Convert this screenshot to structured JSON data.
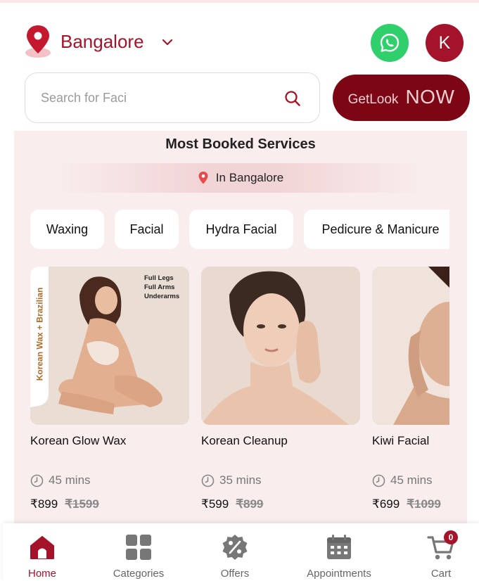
{
  "header": {
    "city": "Bangalore",
    "avatar_initial": "K",
    "search_placeholder": "Search for Faci",
    "cta_getlook": "GetLook",
    "cta_now": "NOW"
  },
  "section": {
    "title": "Most Booked Services",
    "location_label": "In Bangalore"
  },
  "chips": [
    "Waxing",
    "Facial",
    "Hydra Facial",
    "Pedicure & Manicure"
  ],
  "cards": [
    {
      "name": "Korean Glow Wax",
      "duration": "45 mins",
      "price": "₹899",
      "mrp": "₹1599",
      "image_side_text": "Korean Wax + Brazilian",
      "image_list": [
        "Full Legs",
        "Full Arms",
        "Underarms"
      ]
    },
    {
      "name": "Korean Cleanup",
      "duration": "35 mins",
      "price": "₹599",
      "mrp": "₹899"
    },
    {
      "name": "Kiwi Facial",
      "duration": "45 mins",
      "price": "₹699",
      "mrp": "₹1099"
    }
  ],
  "bottom_nav": {
    "home": "Home",
    "categories": "Categories",
    "offers": "Offers",
    "appointments": "Appointments",
    "cart": "Cart",
    "cart_count": "0"
  },
  "colors": {
    "brand": "#a5132a",
    "cta": "#7d0614",
    "whatsapp": "#2fd06b",
    "section_bg": "#f9eded"
  }
}
